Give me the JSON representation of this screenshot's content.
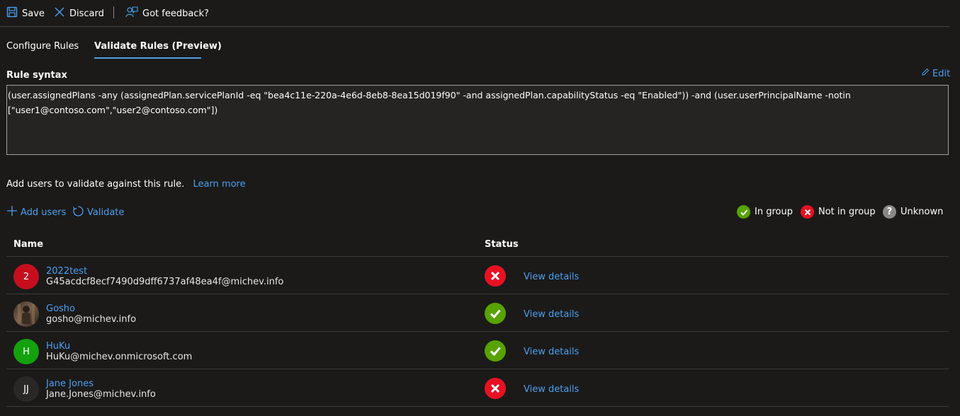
{
  "toolbar": {
    "save_label": "Save",
    "discard_label": "Discard",
    "feedback_label": "Got feedback?"
  },
  "tabs": [
    {
      "label": "Configure Rules",
      "active": false
    },
    {
      "label": "Validate Rules (Preview)",
      "active": true
    }
  ],
  "rule": {
    "heading": "Rule syntax",
    "edit_label": "Edit",
    "text": "(user.assignedPlans -any (assignedPlan.servicePlanId -eq \"bea4c11e-220a-4e6d-8eb8-8ea15d019f90\" -and assignedPlan.capabilityStatus -eq \"Enabled\")) -and (user.userPrincipalName -notin [\"user1@contoso.com\",\"user2@contoso.com\"])"
  },
  "validate": {
    "intro": "Add users to validate against this rule.",
    "learn_more": "Learn more",
    "add_users": "Add users",
    "validate_label": "Validate"
  },
  "legend": {
    "in_group": "In group",
    "not_in_group": "Not in group",
    "unknown": "Unknown"
  },
  "grid": {
    "col_name": "Name",
    "col_status": "Status"
  },
  "users": [
    {
      "initials": "2",
      "name": "2022test",
      "email": "G45acdcf8ecf7490d9dff6737af48ea4f@michev.info",
      "status": "not-in-group",
      "avatar_color": "#c50f1f",
      "details": "View details"
    },
    {
      "initials": "",
      "name": "Gosho",
      "email": "gosho@michev.info",
      "status": "in-group",
      "avatar_color": "#5a4636",
      "details": "View details"
    },
    {
      "initials": "H",
      "name": "HuKu",
      "email": "HuKu@michev.onmicrosoft.com",
      "status": "in-group",
      "avatar_color": "#13a10e",
      "details": "View details"
    },
    {
      "initials": "JJ",
      "name": "Jane Jones",
      "email": "Jane.Jones@michev.info",
      "status": "not-in-group",
      "avatar_color": "#292827",
      "details": "View details"
    }
  ],
  "colors": {
    "accent": "#4aa0f0",
    "success": "#57a300",
    "error": "#e81123",
    "unknown": "#8a8886"
  }
}
